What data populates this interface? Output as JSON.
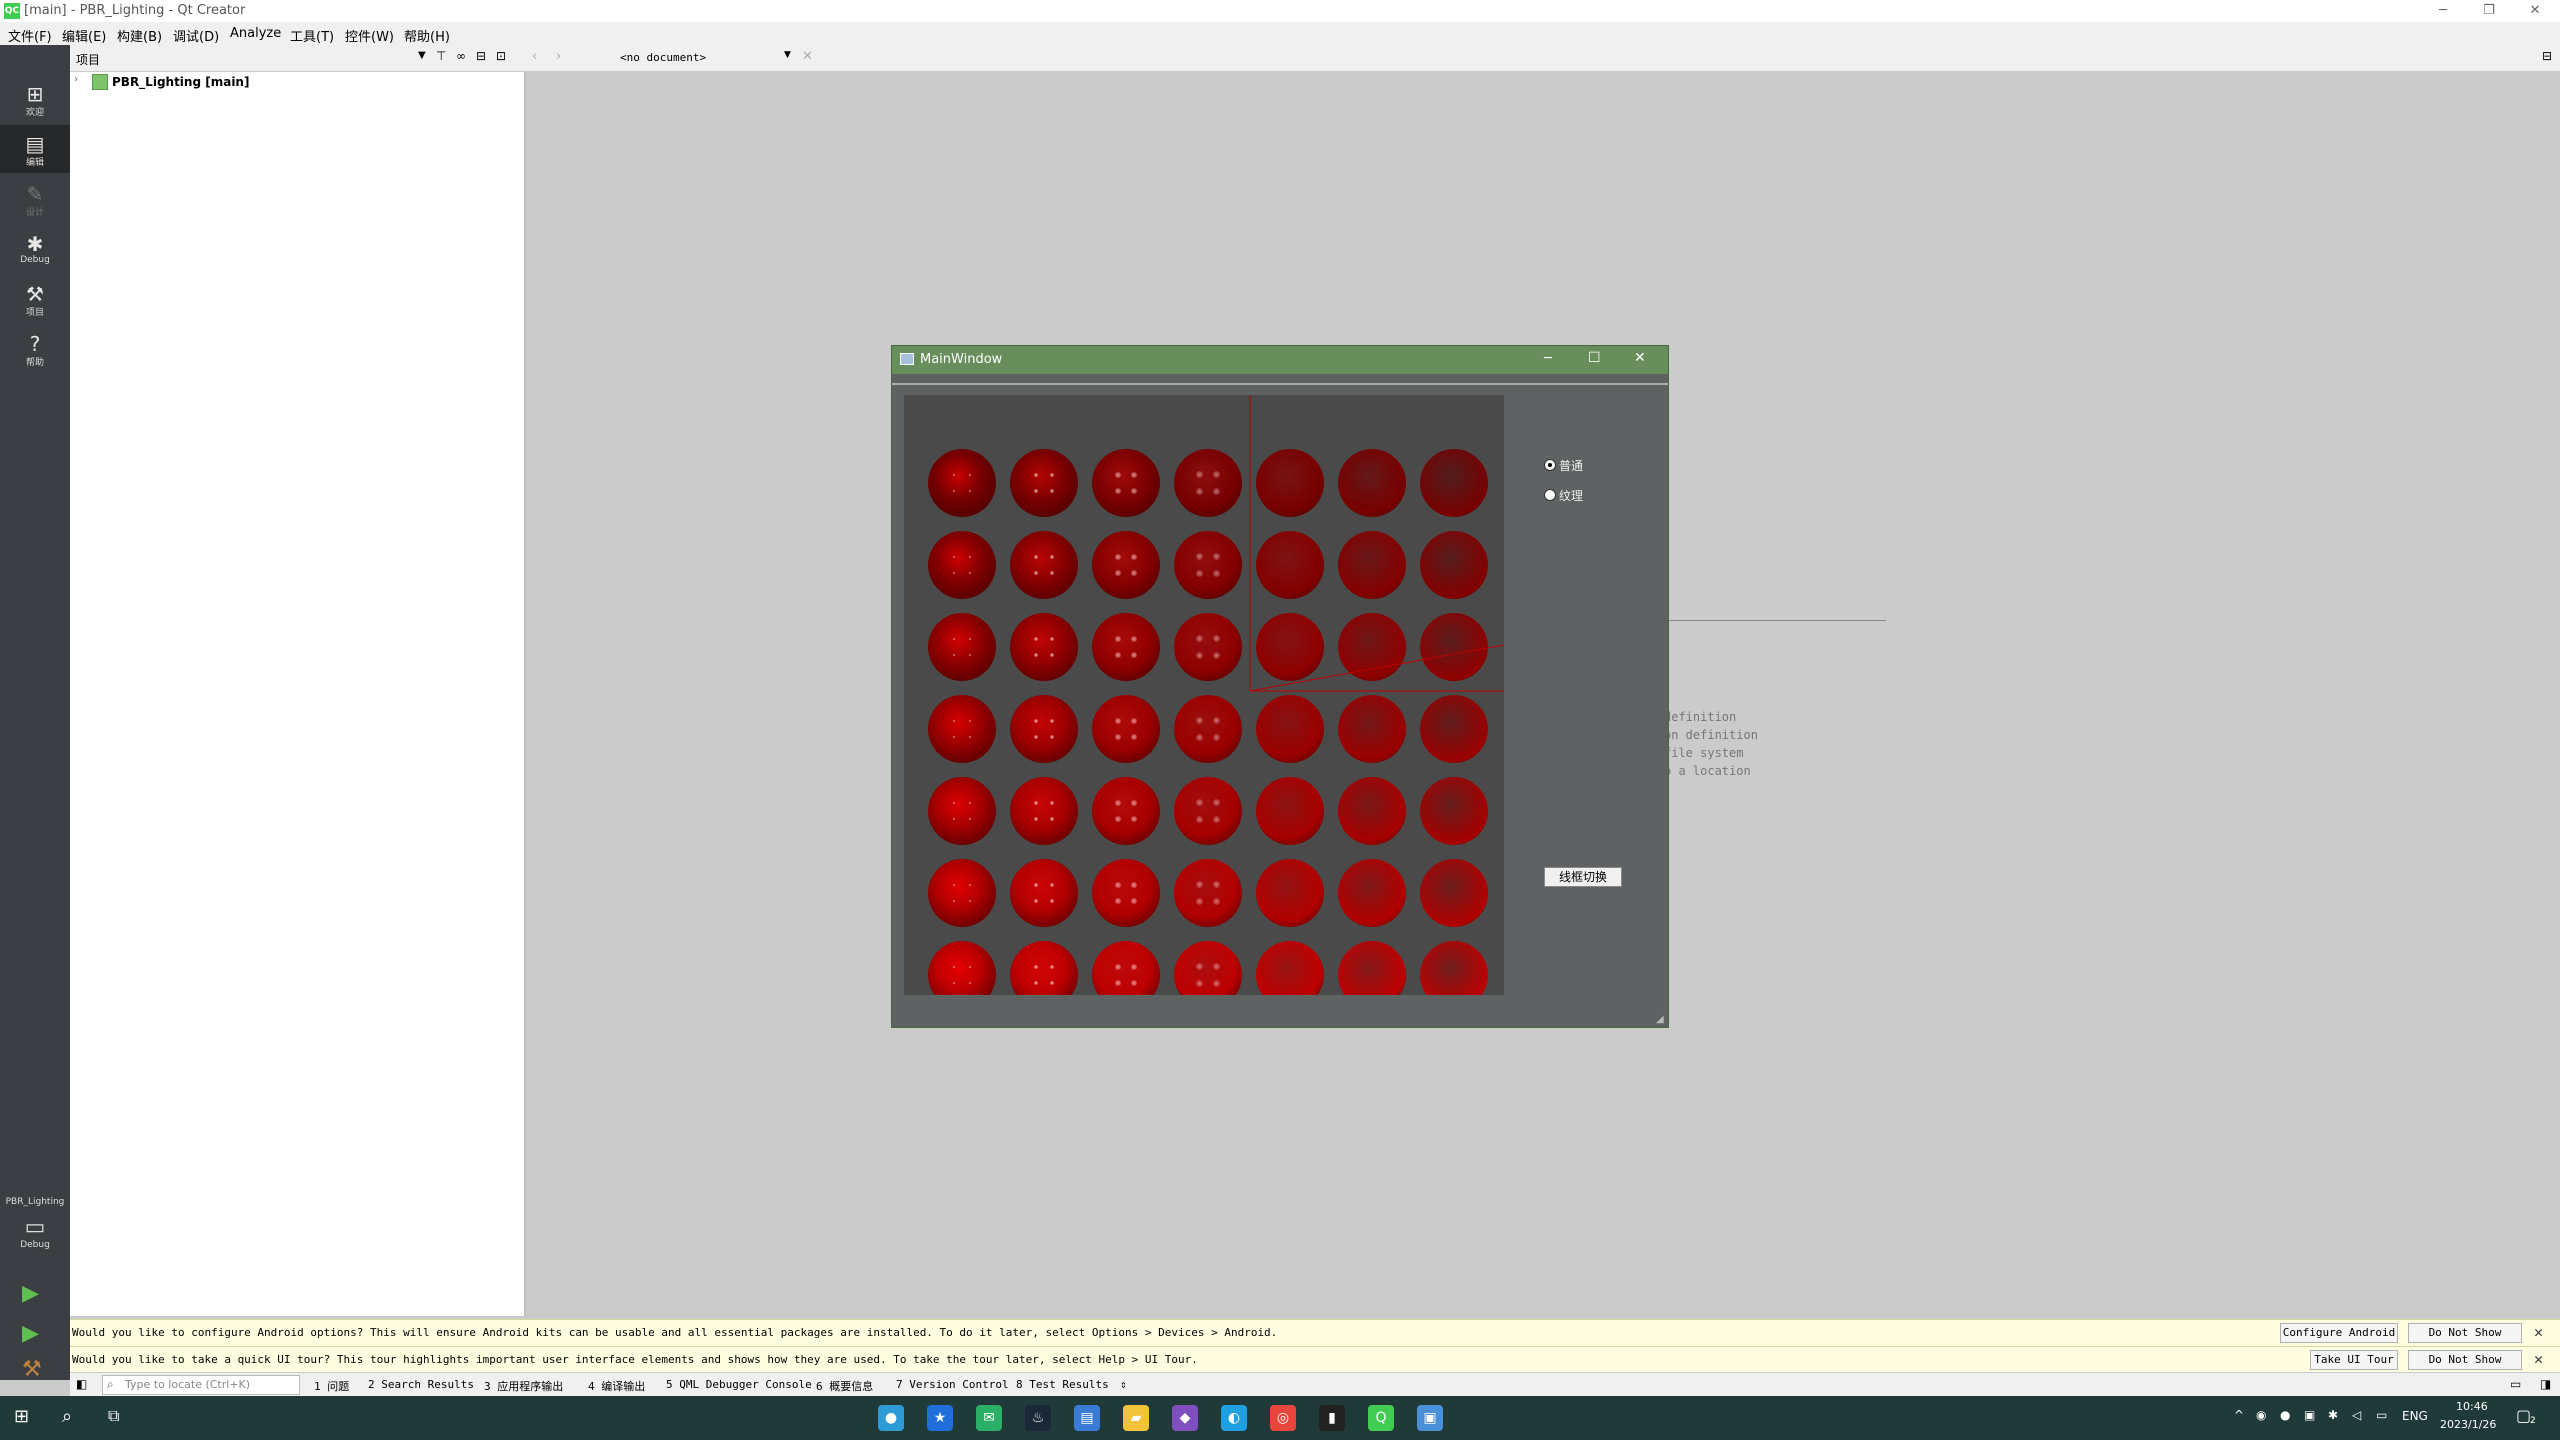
{
  "window": {
    "title": "[main] - PBR_Lighting - Qt Creator",
    "logo_text": "QC",
    "controls": {
      "minimize": "─",
      "maximize": "❐",
      "close": "✕"
    }
  },
  "menubar": {
    "items": [
      "文件(F)",
      "编辑(E)",
      "构建(B)",
      "调试(D)",
      "Analyze",
      "工具(T)",
      "控件(W)",
      "帮助(H)"
    ]
  },
  "modebar": {
    "items": [
      {
        "label": "欢迎",
        "icon": "grid-icon"
      },
      {
        "label": "编辑",
        "icon": "edit-document-icon"
      },
      {
        "label": "设计",
        "icon": "pencil-icon"
      },
      {
        "label": "Debug",
        "icon": "bug-icon"
      },
      {
        "label": "项目",
        "icon": "wrench-icon"
      },
      {
        "label": "帮助",
        "icon": "help-icon"
      }
    ],
    "target_project": "PBR_Lighting",
    "target_config": "Debug"
  },
  "project_panel": {
    "header": "项目",
    "root_item": "PBR_Lighting [main]"
  },
  "editor": {
    "document_selector": "<no document>",
    "welcome_hints": [
      "definition",
      "on definition",
      "file system",
      "o a location"
    ]
  },
  "main_window": {
    "title": "MainWindow",
    "controls": {
      "minimize": "─",
      "maximize": "☐",
      "close": "✕"
    },
    "radio_options": [
      {
        "label": "普通",
        "checked": true
      },
      {
        "label": "纹理",
        "checked": false
      }
    ],
    "button_label": "线框切换",
    "sphere_grid": {
      "rows": 7,
      "cols": 7
    }
  },
  "infobars": [
    {
      "text": "Would you like to configure Android options? This will ensure Android kits can be usable and all essential packages are installed. To do it later, select Options > Devices > Android.",
      "buttons": [
        "Configure Android",
        "Do Not Show Again"
      ]
    },
    {
      "text": "Would you like to take a quick UI tour? This tour highlights important user interface elements and shows how they are used. To take the tour later, select Help > UI Tour.",
      "buttons": [
        "Take UI Tour",
        "Do Not Show Again"
      ]
    }
  ],
  "output_bar": {
    "locator_placeholder": "Type to locate (Ctrl+K)",
    "tabs": [
      "1 问题",
      "2 Search Results",
      "3 应用程序输出",
      "4 编译输出",
      "5 QML Debugger Console",
      "6 概要信息",
      "7 Version Control",
      "8 Test Results"
    ]
  },
  "taskbar": {
    "apps": [
      "qt-icon",
      "store-icon",
      "wechat-icon",
      "steam-icon",
      "app-icon",
      "folder-icon",
      "visual-studio-icon",
      "edge-icon",
      "chrome-icon",
      "terminal-icon",
      "qt-creator-icon",
      "window-icon"
    ],
    "lang": "ENG",
    "time": "10:46",
    "date": "2023/1/26",
    "notification_count": "2"
  },
  "colors": {
    "modebar_bg": "#3b3e42",
    "main_window_titlebar": "#688e5b",
    "taskbar_bg": "#1f3a38",
    "sphere_red": "#b80000"
  }
}
